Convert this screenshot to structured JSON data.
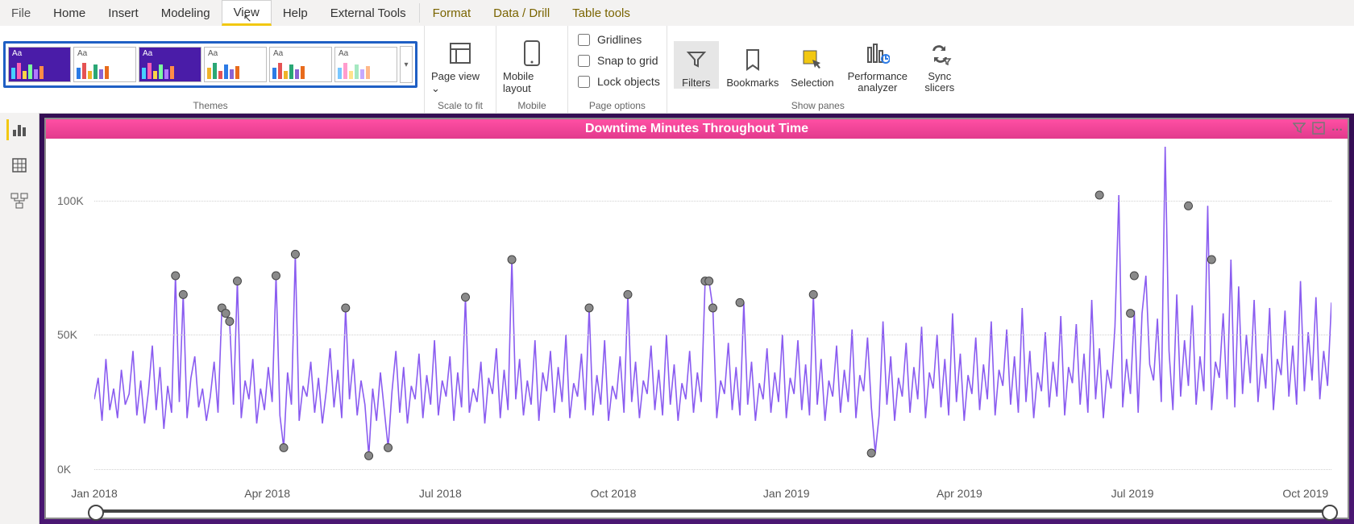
{
  "menu": {
    "file": "File",
    "home": "Home",
    "insert": "Insert",
    "modeling": "Modeling",
    "view": "View",
    "help": "Help",
    "external": "External Tools",
    "format": "Format",
    "datadrill": "Data / Drill",
    "tabletools": "Table tools"
  },
  "ribbon": {
    "themes_label": "Themes",
    "theme_tile_text": "Aa",
    "scale_label": "Scale to fit",
    "pageview": "Page view",
    "pageview_caret": "⌄",
    "mobile_label": "Mobile",
    "mobile": "Mobile layout",
    "pageoptions_label": "Page options",
    "gridlines": "Gridlines",
    "snap": "Snap to grid",
    "lock": "Lock objects",
    "showpanes_label": "Show panes",
    "filters": "Filters",
    "bookmarks": "Bookmarks",
    "selection": "Selection",
    "perf": "Performance analyzer",
    "sync": "Sync slicers"
  },
  "rail": {
    "report": "report-view",
    "data": "data-view",
    "model": "model-view"
  },
  "visual": {
    "title": "Downtime Minutes Throughout Time",
    "tools": {
      "filter": "▾",
      "focus": "⛶",
      "more": "⋯"
    }
  },
  "chart_data": {
    "type": "line",
    "title": "Downtime Minutes Throughout Time",
    "xlabel": "",
    "ylabel": "",
    "ylim": [
      0,
      120000
    ],
    "yticks": [
      {
        "v": 0,
        "label": "0K"
      },
      {
        "v": 50000,
        "label": "50K"
      },
      {
        "v": 100000,
        "label": "100K"
      }
    ],
    "xticks": [
      "Jan 2018",
      "Apr 2018",
      "Jul 2018",
      "Oct 2018",
      "Jan 2019",
      "Apr 2019",
      "Jul 2019",
      "Oct 2019"
    ],
    "x_range": [
      "2018-01-01",
      "2019-12-31"
    ],
    "values": [
      26000,
      34000,
      18000,
      41000,
      22000,
      30000,
      19000,
      37000,
      24000,
      28000,
      44000,
      20000,
      33000,
      17000,
      29000,
      46000,
      22000,
      38000,
      15000,
      31000,
      21000,
      72000,
      25000,
      65000,
      19000,
      34000,
      42000,
      23000,
      30000,
      18000,
      27000,
      40000,
      21000,
      60000,
      58000,
      55000,
      24000,
      70000,
      19000,
      33000,
      26000,
      41000,
      17000,
      30000,
      22000,
      38000,
      25000,
      72000,
      20000,
      8000,
      36000,
      24000,
      80000,
      18000,
      31000,
      27000,
      40000,
      21000,
      34000,
      17000,
      29000,
      45000,
      23000,
      37000,
      19000,
      60000,
      26000,
      41000,
      20000,
      33000,
      24000,
      5000,
      30000,
      18000,
      36000,
      22000,
      8000,
      29000,
      44000,
      21000,
      38000,
      17000,
      31000,
      26000,
      43000,
      19000,
      35000,
      24000,
      48000,
      20000,
      33000,
      27000,
      42000,
      18000,
      36000,
      23000,
      64000,
      21000,
      30000,
      25000,
      40000,
      17000,
      34000,
      28000,
      45000,
      19000,
      37000,
      22000,
      78000,
      26000,
      41000,
      20000,
      33000,
      24000,
      48000,
      18000,
      36000,
      29000,
      44000,
      21000,
      38000,
      25000,
      50000,
      19000,
      32000,
      27000,
      43000,
      22000,
      60000,
      20000,
      35000,
      24000,
      48000,
      18000,
      31000,
      26000,
      42000,
      21000,
      65000,
      25000,
      40000,
      19000,
      33000,
      28000,
      46000,
      22000,
      37000,
      20000,
      50000,
      24000,
      39000,
      18000,
      32000,
      26000,
      44000,
      21000,
      36000,
      25000,
      70000,
      70000,
      60000,
      19000,
      33000,
      28000,
      47000,
      22000,
      38000,
      20000,
      62000,
      24000,
      40000,
      18000,
      32000,
      26000,
      45000,
      21000,
      36000,
      25000,
      50000,
      19000,
      34000,
      28000,
      48000,
      22000,
      39000,
      20000,
      65000,
      24000,
      41000,
      18000,
      33000,
      27000,
      46000,
      21000,
      37000,
      25000,
      52000,
      19000,
      35000,
      29000,
      49000,
      23000,
      6000,
      20000,
      55000,
      24000,
      42000,
      18000,
      34000,
      27000,
      47000,
      21000,
      38000,
      26000,
      53000,
      19000,
      36000,
      30000,
      50000,
      23000,
      41000,
      20000,
      58000,
      25000,
      43000,
      18000,
      35000,
      28000,
      49000,
      22000,
      39000,
      26000,
      55000,
      20000,
      37000,
      31000,
      52000,
      24000,
      42000,
      21000,
      60000,
      25000,
      44000,
      19000,
      36000,
      29000,
      51000,
      23000,
      40000,
      27000,
      57000,
      20000,
      38000,
      32000,
      54000,
      24000,
      43000,
      21000,
      63000,
      26000,
      45000,
      19000,
      37000,
      30000,
      53000,
      102000,
      23000,
      41000,
      28000,
      59000,
      21000,
      58000,
      72000,
      39000,
      33000,
      56000,
      25000,
      120000,
      44000,
      22000,
      65000,
      27000,
      48000,
      31000,
      61000,
      24000,
      42000,
      29000,
      98000,
      22000,
      40000,
      34000,
      58000,
      26000,
      78000,
      23000,
      68000,
      28000,
      50000,
      32000,
      63000,
      25000,
      43000,
      30000,
      60000,
      22000,
      41000,
      35000,
      59000,
      27000,
      46000,
      24000,
      70000,
      29000,
      51000,
      33000,
      64000,
      26000,
      44000,
      31000,
      62000
    ],
    "anomalies": [
      {
        "i": 21,
        "v": 72000
      },
      {
        "i": 23,
        "v": 65000
      },
      {
        "i": 33,
        "v": 60000
      },
      {
        "i": 34,
        "v": 58000
      },
      {
        "i": 35,
        "v": 55000
      },
      {
        "i": 37,
        "v": 70000
      },
      {
        "i": 47,
        "v": 72000
      },
      {
        "i": 49,
        "v": 8000
      },
      {
        "i": 52,
        "v": 80000
      },
      {
        "i": 65,
        "v": 60000
      },
      {
        "i": 71,
        "v": 5000
      },
      {
        "i": 76,
        "v": 8000
      },
      {
        "i": 96,
        "v": 64000
      },
      {
        "i": 108,
        "v": 78000
      },
      {
        "i": 128,
        "v": 60000
      },
      {
        "i": 138,
        "v": 65000
      },
      {
        "i": 158,
        "v": 70000
      },
      {
        "i": 159,
        "v": 70000
      },
      {
        "i": 160,
        "v": 60000
      },
      {
        "i": 167,
        "v": 62000
      },
      {
        "i": 186,
        "v": 65000
      },
      {
        "i": 201,
        "v": 6000
      },
      {
        "i": 260,
        "v": 102000
      },
      {
        "i": 268,
        "v": 58000
      },
      {
        "i": 269,
        "v": 72000
      },
      {
        "i": 283,
        "v": 98000
      },
      {
        "i": 289,
        "v": 78000
      }
    ],
    "color": "#8a5cf0"
  }
}
